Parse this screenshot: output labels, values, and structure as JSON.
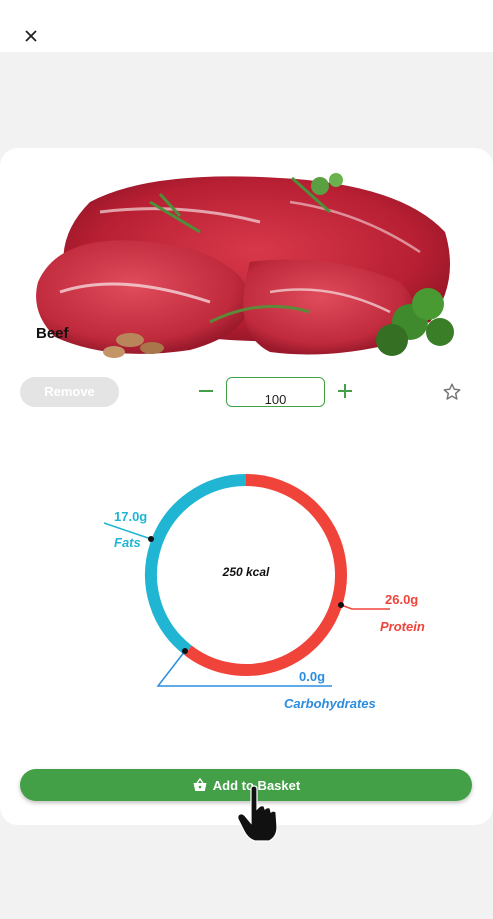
{
  "header": {
    "close_icon": "close-icon"
  },
  "product": {
    "name": "Beef",
    "image_icon": "beef-photo"
  },
  "controls": {
    "remove_label": "Remove",
    "quantity": "100",
    "minus_icon": "minus-icon",
    "plus_icon": "plus-icon",
    "favorite_icon": "star-outline-icon"
  },
  "nutrition": {
    "kcal": "250 kcal",
    "fats": {
      "value": "17.0g",
      "label": "Fats",
      "grams": 17.0,
      "color": "#1fb5d3"
    },
    "protein": {
      "value": "26.0g",
      "label": "Protein",
      "grams": 26.0,
      "color": "#f0443a"
    },
    "carbohydrates": {
      "value": "0.0g",
      "label": "Carbohydrates",
      "grams": 0.0,
      "color": "#2b8de0"
    }
  },
  "actions": {
    "add_to_basket_label": "Add to Basket",
    "basket_icon": "basket-icon"
  },
  "colors": {
    "accent": "#43a047",
    "fats": "#1fb5d3",
    "protein": "#f0443a",
    "carbs": "#2b8de0"
  }
}
